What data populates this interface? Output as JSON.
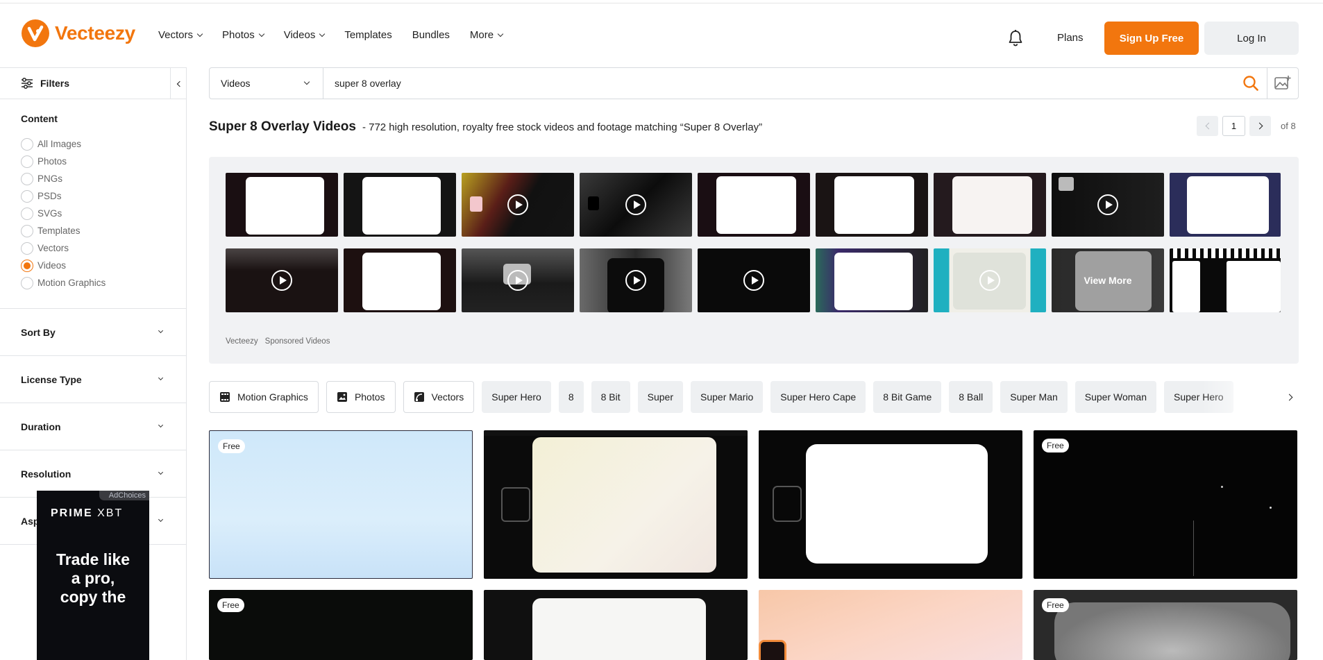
{
  "brand": {
    "name": "Vecteezy",
    "accent": "#f2760e"
  },
  "nav": {
    "items": [
      {
        "label": "Vectors",
        "dropdown": true
      },
      {
        "label": "Photos",
        "dropdown": true
      },
      {
        "label": "Videos",
        "dropdown": true
      },
      {
        "label": "Templates",
        "dropdown": false
      },
      {
        "label": "Bundles",
        "dropdown": false
      },
      {
        "label": "More",
        "dropdown": true
      }
    ],
    "plans": "Plans",
    "signup": "Sign Up Free",
    "login": "Log In",
    "bell_icon": "bell-icon"
  },
  "sidebar": {
    "filters_label": "Filters",
    "content_title": "Content",
    "content_options": [
      {
        "label": "All Images",
        "selected": false
      },
      {
        "label": "Photos",
        "selected": false
      },
      {
        "label": "PNGs",
        "selected": false
      },
      {
        "label": "PSDs",
        "selected": false
      },
      {
        "label": "SVGs",
        "selected": false
      },
      {
        "label": "Templates",
        "selected": false
      },
      {
        "label": "Vectors",
        "selected": false
      },
      {
        "label": "Videos",
        "selected": true
      },
      {
        "label": "Motion Graphics",
        "selected": false
      }
    ],
    "sections": [
      "Sort By",
      "License Type",
      "Duration",
      "Resolution",
      "Aspect Ratio"
    ]
  },
  "ad": {
    "choices": "AdChoices",
    "brand_bold": "PRIME",
    "brand_light": "XBT",
    "headline_1": "Trade like",
    "headline_2": "a pro,",
    "headline_3": "copy the"
  },
  "search": {
    "type": "Videos",
    "query": "super 8 overlay"
  },
  "results": {
    "title": "Super 8 Overlay Videos",
    "subtitle": "- 772 high resolution, royalty free stock videos and footage matching “Super 8 Overlay”",
    "page": "1",
    "of_pages": "of 8"
  },
  "sponsored": {
    "view_more": "View More",
    "source": "Vecteezy",
    "label": "Sponsored Videos"
  },
  "tags": [
    {
      "label": "Motion Graphics",
      "icon": "motion-graphics-icon",
      "outlined": true
    },
    {
      "label": "Photos",
      "icon": "photo-icon",
      "outlined": true
    },
    {
      "label": "Vectors",
      "icon": "vector-icon",
      "outlined": true
    },
    {
      "label": "Super Hero"
    },
    {
      "label": "8"
    },
    {
      "label": "8 Bit"
    },
    {
      "label": "Super"
    },
    {
      "label": "Super Mario"
    },
    {
      "label": "Super Hero Cape"
    },
    {
      "label": "8 Bit Game"
    },
    {
      "label": "8 Ball"
    },
    {
      "label": "Super Man"
    },
    {
      "label": "Super Woman"
    },
    {
      "label": "Super Hero"
    }
  ],
  "grid": {
    "free_badge": "Free"
  }
}
